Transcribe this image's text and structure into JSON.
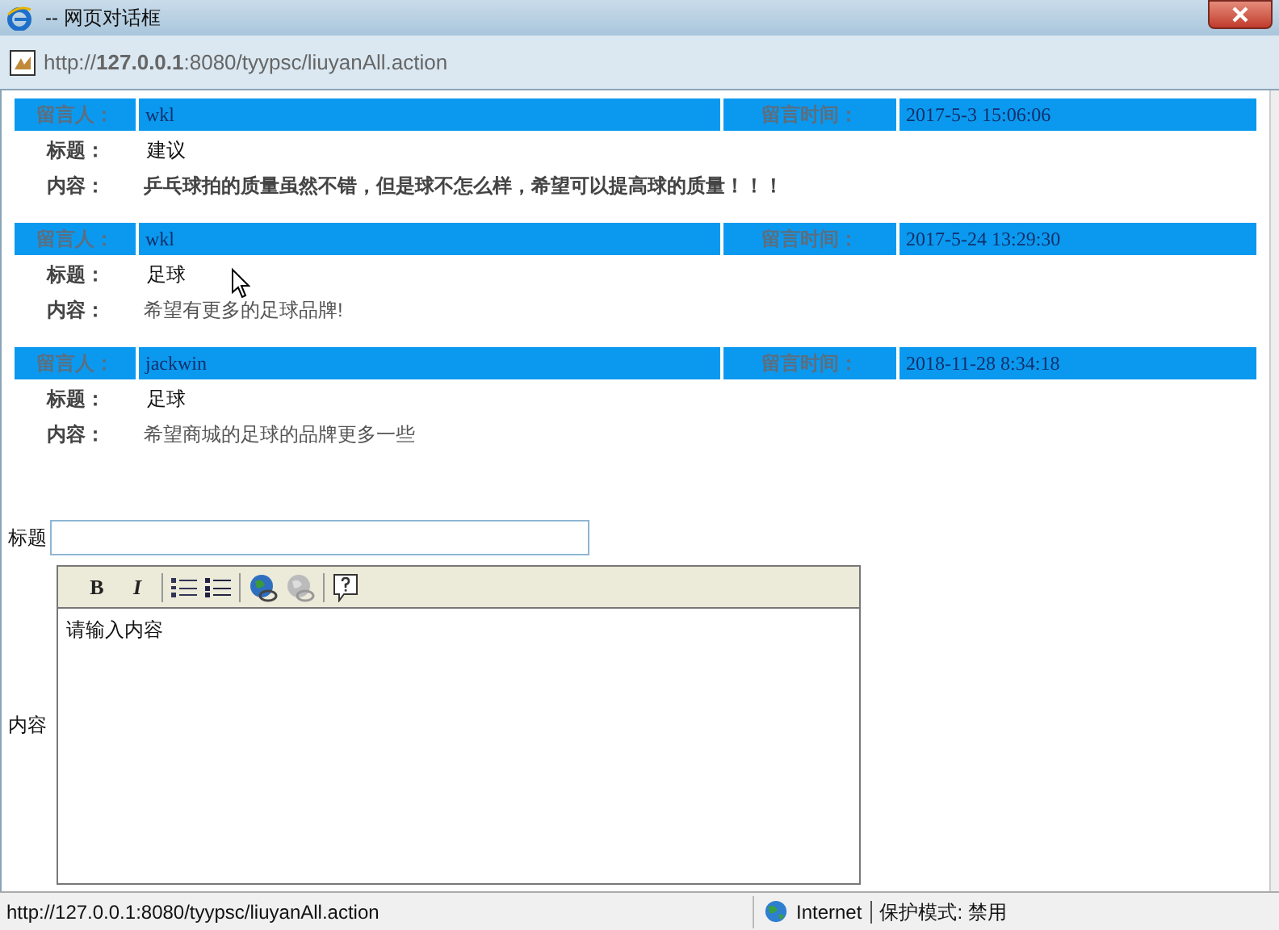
{
  "window": {
    "title": "-- 网页对话框"
  },
  "address": "http://**127.0.0.1**:8080/tyypsc/liuyanAll.action",
  "messages": [
    {
      "author_label": "留言人：",
      "author": "wkl",
      "time_label": "留言时间：",
      "time": "2017-5-3 15:06:06",
      "title_label": "标题：",
      "title": "建议",
      "content_label": "内容：",
      "content": "乒乓球拍的质量虽然不错，但是球不怎么样，希望可以提高球的质量！！！",
      "bold": true
    },
    {
      "author_label": "留言人：",
      "author": "wkl",
      "time_label": "留言时间：",
      "time": "2017-5-24 13:29:30",
      "title_label": "标题：",
      "title": "足球",
      "content_label": "内容：",
      "content": "希望有更多的足球品牌!",
      "bold": false
    },
    {
      "author_label": "留言人：",
      "author": "jackwin",
      "time_label": "留言时间：",
      "time": "2018-11-28 8:34:18",
      "title_label": "标题：",
      "title": "足球",
      "content_label": "内容：",
      "content": "希望商城的足球的品牌更多一些",
      "bold": false
    }
  ],
  "form": {
    "title_label": "标题",
    "content_label": "内容",
    "editor_value": "请输入内容",
    "toolbar": [
      {
        "kind": "bold",
        "label": "B",
        "disabled": false
      },
      {
        "kind": "italic",
        "label": "I",
        "disabled": false
      },
      {
        "kind": "ordered-list",
        "disabled": false
      },
      {
        "kind": "bullet-list",
        "disabled": false
      },
      {
        "kind": "link",
        "disabled": false
      },
      {
        "kind": "unlink",
        "disabled": true
      },
      {
        "kind": "help",
        "disabled": false
      }
    ]
  },
  "status_bar": {
    "url": "http://127.0.0.1:8080/tyypsc/liuyanAll.action",
    "zone": "Internet",
    "protected_mode": "保护模式: 禁用"
  }
}
